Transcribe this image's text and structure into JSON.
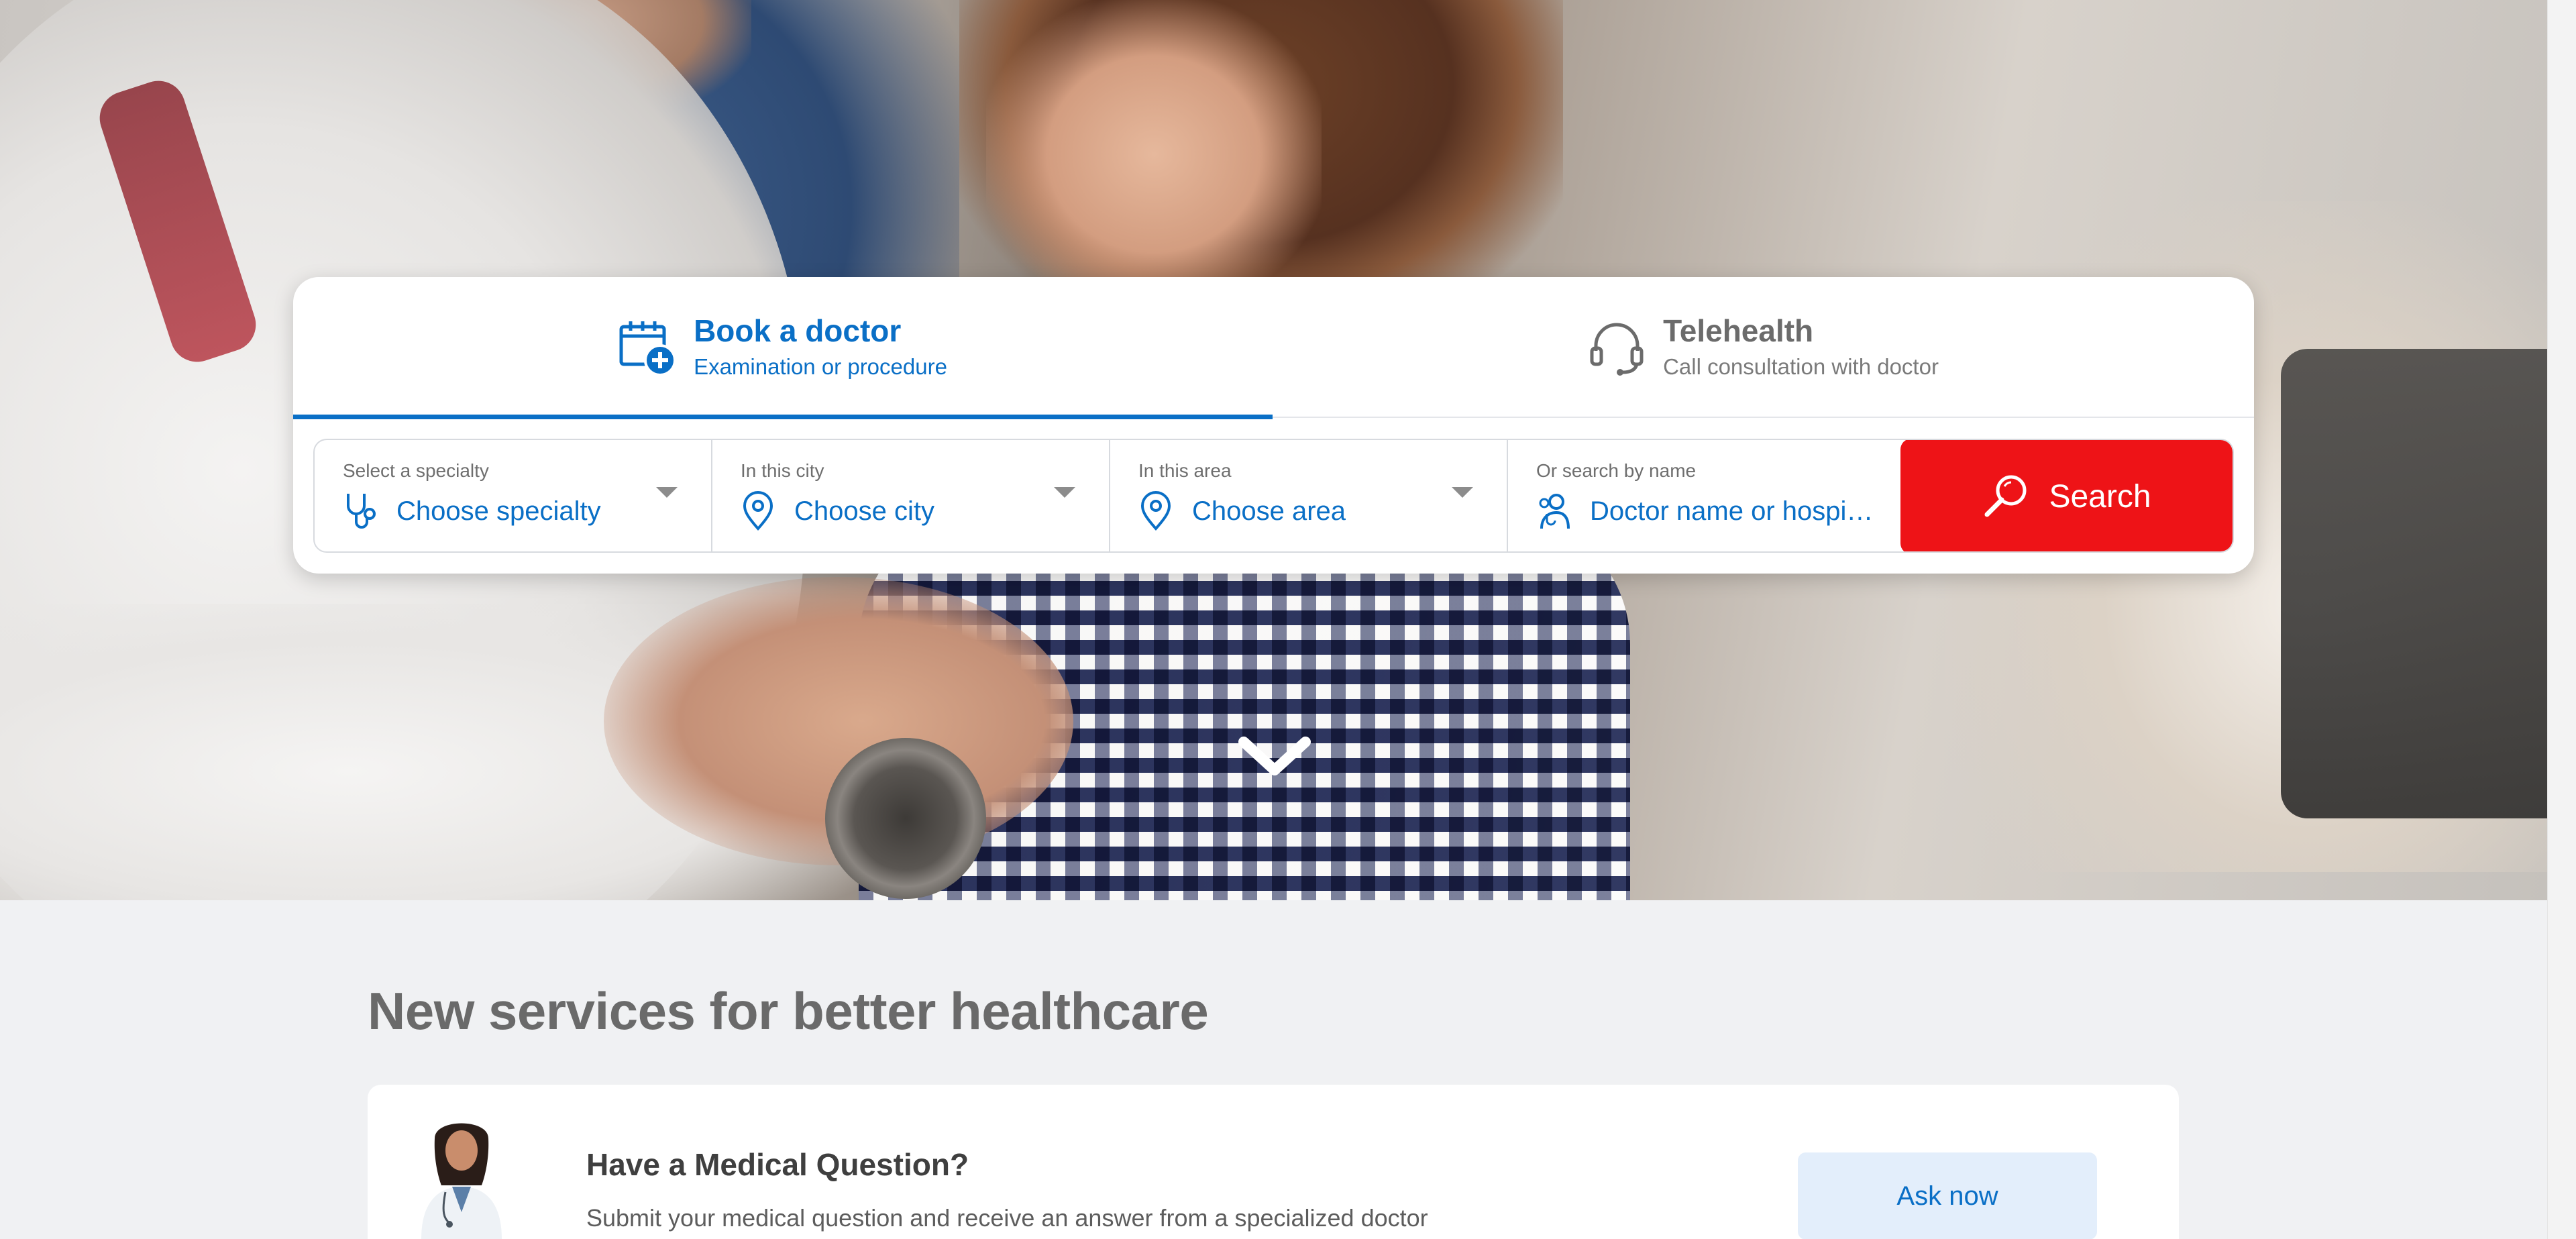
{
  "colors": {
    "primary": "#0a6fc6",
    "search_button": "#ee1317",
    "ask_button_bg": "#e3eefb",
    "page_bg": "#f0f1f3"
  },
  "hero": {
    "scroll_icon": "chevron-down-icon"
  },
  "tabs": [
    {
      "title": "Book a doctor",
      "subtitle": "Examination or procedure",
      "icon": "calendar-plus-icon",
      "active": true
    },
    {
      "title": "Telehealth",
      "subtitle": "Call consultation with doctor",
      "icon": "headset-icon",
      "active": false
    }
  ],
  "search": {
    "specialty": {
      "label": "Select a specialty",
      "value": "Choose specialty",
      "icon": "stethoscope-icon"
    },
    "city": {
      "label": "In this city",
      "value": "Choose city",
      "icon": "location-pin-icon"
    },
    "area": {
      "label": "In this area",
      "value": "Choose area",
      "icon": "location-pin-icon"
    },
    "name": {
      "label": "Or search by name",
      "placeholder": "Doctor name or hospi…",
      "icon": "doctor-icon"
    },
    "button_label": "Search",
    "button_icon": "magnifier-icon"
  },
  "services": {
    "heading": "New services for better healthcare",
    "card": {
      "title": "Have a Medical Question?",
      "description": "Submit your medical question and receive an answer from a specialized doctor",
      "button_label": "Ask now"
    }
  }
}
